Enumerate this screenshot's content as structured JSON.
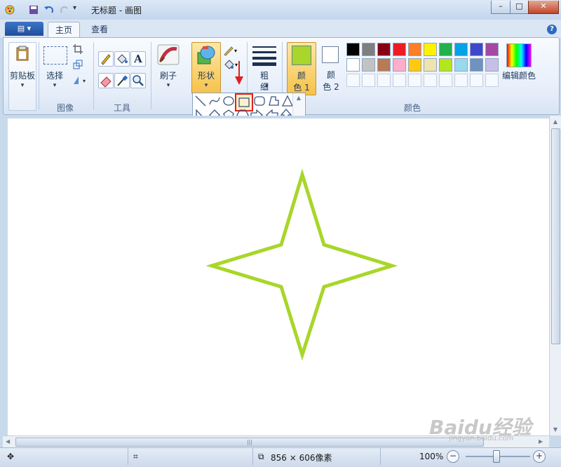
{
  "window": {
    "title": "无标题 - 画图",
    "minimize": "–",
    "maximize": "□",
    "close": "✕"
  },
  "tabs": {
    "file": "▤ ▾",
    "home": "主页",
    "view": "查看",
    "help": "?"
  },
  "ribbon": {
    "clipboard": {
      "label": "剪贴板",
      "arrow": "▾"
    },
    "select": {
      "label": "选择",
      "arrow": "▾"
    },
    "image_group": "图像",
    "tools_group": "工具",
    "brushes": {
      "label": "刷子",
      "arrow": "▾"
    },
    "shapes": {
      "label": "形状",
      "arrow": "▾"
    },
    "size": {
      "label_line1": "粗",
      "label_line2": "细",
      "arrow": "▾"
    },
    "color1": {
      "label_line1": "颜",
      "label_line2": "色 1",
      "value": "#a8d62a"
    },
    "color2": {
      "label_line1": "颜",
      "label_line2": "色 2",
      "value": "#ffffff"
    },
    "edit_colors": "编辑颜色",
    "colors_group": "颜色",
    "text_tool": "A"
  },
  "palette": {
    "row1": [
      "#000000",
      "#7f7f7f",
      "#880015",
      "#ed1c24",
      "#ff7f27",
      "#fff200",
      "#22b14c",
      "#00a2e8",
      "#3f48cc",
      "#a349a4"
    ],
    "row2": [
      "#ffffff",
      "#c3c3c3",
      "#b97a57",
      "#ffaec9",
      "#ffc90e",
      "#efe4b0",
      "#b5e61d",
      "#99d9ea",
      "#7092be",
      "#c8bfe7"
    ]
  },
  "drawing": {
    "stroke_color": "#a8d62a",
    "shape": "four-point-star"
  },
  "status": {
    "size_text": "856 × 606像素",
    "zoom": "100%",
    "zoom_out": "−",
    "zoom_in": "+",
    "cursor_icon": "✥",
    "selection_icon": "⌗"
  },
  "watermark": {
    "text": "Baidu经验",
    "url": "jingyan.baidu.com"
  }
}
